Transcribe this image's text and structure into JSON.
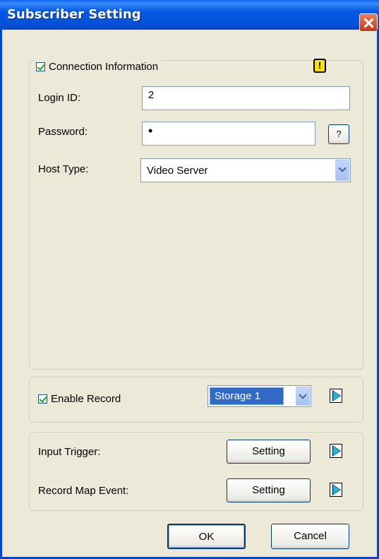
{
  "window": {
    "title": "Subscriber Setting"
  },
  "connection": {
    "checkbox_label": "Connection Information",
    "checked": true,
    "warning_glyph": "!",
    "login_label": "Login ID:",
    "login_value": "2",
    "password_label": "Password:",
    "password_value": "•",
    "help_glyph": "?",
    "host_type_label": "Host Type:",
    "host_type_value": "Video Server"
  },
  "record": {
    "checkbox_label": "Enable Record",
    "checked": true,
    "storage_value": "Storage 1"
  },
  "triggers": {
    "input_trigger_label": "Input Trigger:",
    "input_trigger_button": "Setting",
    "record_map_label": "Record Map Event:",
    "record_map_button": "Setting"
  },
  "footer": {
    "ok_label": "OK",
    "cancel_label": "Cancel"
  }
}
